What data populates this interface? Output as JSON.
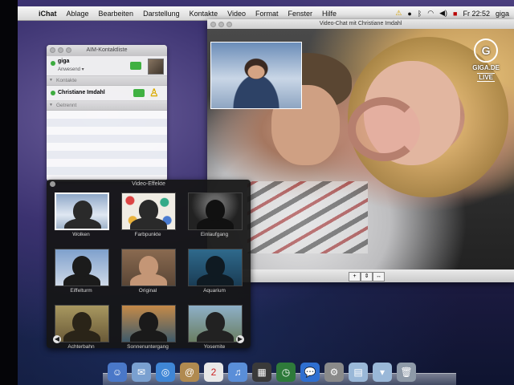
{
  "menubar": {
    "apple": "",
    "items": [
      "iChat",
      "Ablage",
      "Bearbeiten",
      "Darstellung",
      "Kontakte",
      "Video",
      "Format",
      "Fenster",
      "Hilfe"
    ],
    "clock": "Fr 22:52",
    "user": "giga"
  },
  "buddy_list": {
    "title": "AIM-Kontaktliste",
    "me": {
      "name": "giga",
      "status": "Anwesend ▾"
    },
    "groups": [
      {
        "label": "Kontakte",
        "contacts": [
          {
            "name": "Christiane Imdahl"
          }
        ]
      },
      {
        "label": "Getrennt"
      }
    ]
  },
  "video_chat": {
    "title": "Video-Chat mit Christiane Imdahl",
    "overlay": {
      "logo": "G",
      "brand": "GIGA.DE",
      "live": "LIVE"
    },
    "controls": [
      "+",
      "⇕",
      "↔"
    ]
  },
  "video_effects": {
    "title": "Video-Effekte",
    "effects": [
      {
        "label": "Wolken",
        "selected": true,
        "bg": "linear-gradient(180deg,#8fa8c8,#dfe7f2 60%,#9fb2c9)",
        "sil": "#2a2a2a"
      },
      {
        "label": "Farbpunkte",
        "bg": "radial-gradient(circle at 15% 20%,#d44 0 5px,transparent 6px),radial-gradient(circle at 80% 25%,#3a8 0 5px,transparent 6px),radial-gradient(circle at 20% 75%,#e9b23c 0 5px,transparent 6px),radial-gradient(circle at 85% 75%,#4a7bd0 0 5px,transparent 6px),#f0ece4",
        "sil": "#2a2a2a"
      },
      {
        "label": "Einlaufgang",
        "bg": "radial-gradient(ellipse at 50% 30%,#666 0 10px,#222 30px)",
        "sil": "#111"
      },
      {
        "label": "Eiffelturm",
        "bg": "linear-gradient(180deg,#7ea0cc,#cfd9e8)",
        "sil": "#1b1b1b"
      },
      {
        "label": "Original",
        "bg": "linear-gradient(180deg,#8a6a50,#5a4636)",
        "sil": "#c49676"
      },
      {
        "label": "Aquarium",
        "bg": "linear-gradient(180deg,#2f6a8c,#1a3d55)",
        "sil": "#0f1a22"
      },
      {
        "label": "Achterbahn",
        "bg": "linear-gradient(180deg,#a89860,#6a5a38)",
        "sil": "#2a2418"
      },
      {
        "label": "Sonnenuntergang",
        "bg": "linear-gradient(180deg,#c48a48,#3e5a6a)",
        "sil": "#1a1a1a"
      },
      {
        "label": "Yosemite",
        "bg": "linear-gradient(180deg,#8eb0c8,#6a7e62)",
        "sil": "#222"
      }
    ],
    "prev": "◀",
    "next": "▶"
  },
  "dock": {
    "items": [
      {
        "name": "finder-icon",
        "glyph": "☺",
        "color": "#4a78c8"
      },
      {
        "name": "mail-icon",
        "glyph": "✉",
        "color": "#7aa0d0"
      },
      {
        "name": "safari-icon",
        "glyph": "◎",
        "color": "#3f86d6"
      },
      {
        "name": "address-book-icon",
        "glyph": "@",
        "color": "#b08a50"
      },
      {
        "name": "ical-icon",
        "glyph": "2",
        "color": "#e8e8e8"
      },
      {
        "name": "itunes-icon",
        "glyph": "♫",
        "color": "#5a8ed8"
      },
      {
        "name": "photo-booth-icon",
        "glyph": "▦",
        "color": "#3a3a3a"
      },
      {
        "name": "time-machine-icon",
        "glyph": "◷",
        "color": "#2e7a3a"
      },
      {
        "name": "ichat-icon",
        "glyph": "💬",
        "color": "#2f6fd0"
      },
      {
        "name": "system-prefs-icon",
        "glyph": "⚙",
        "color": "#8a8a8a"
      },
      {
        "name": "documents-folder-icon",
        "glyph": "▤",
        "color": "#9ab8d8"
      },
      {
        "name": "downloads-folder-icon",
        "glyph": "▾",
        "color": "#9ab8d8"
      },
      {
        "name": "trash-icon",
        "glyph": "🗑",
        "color": "#8e9aa8"
      }
    ]
  }
}
